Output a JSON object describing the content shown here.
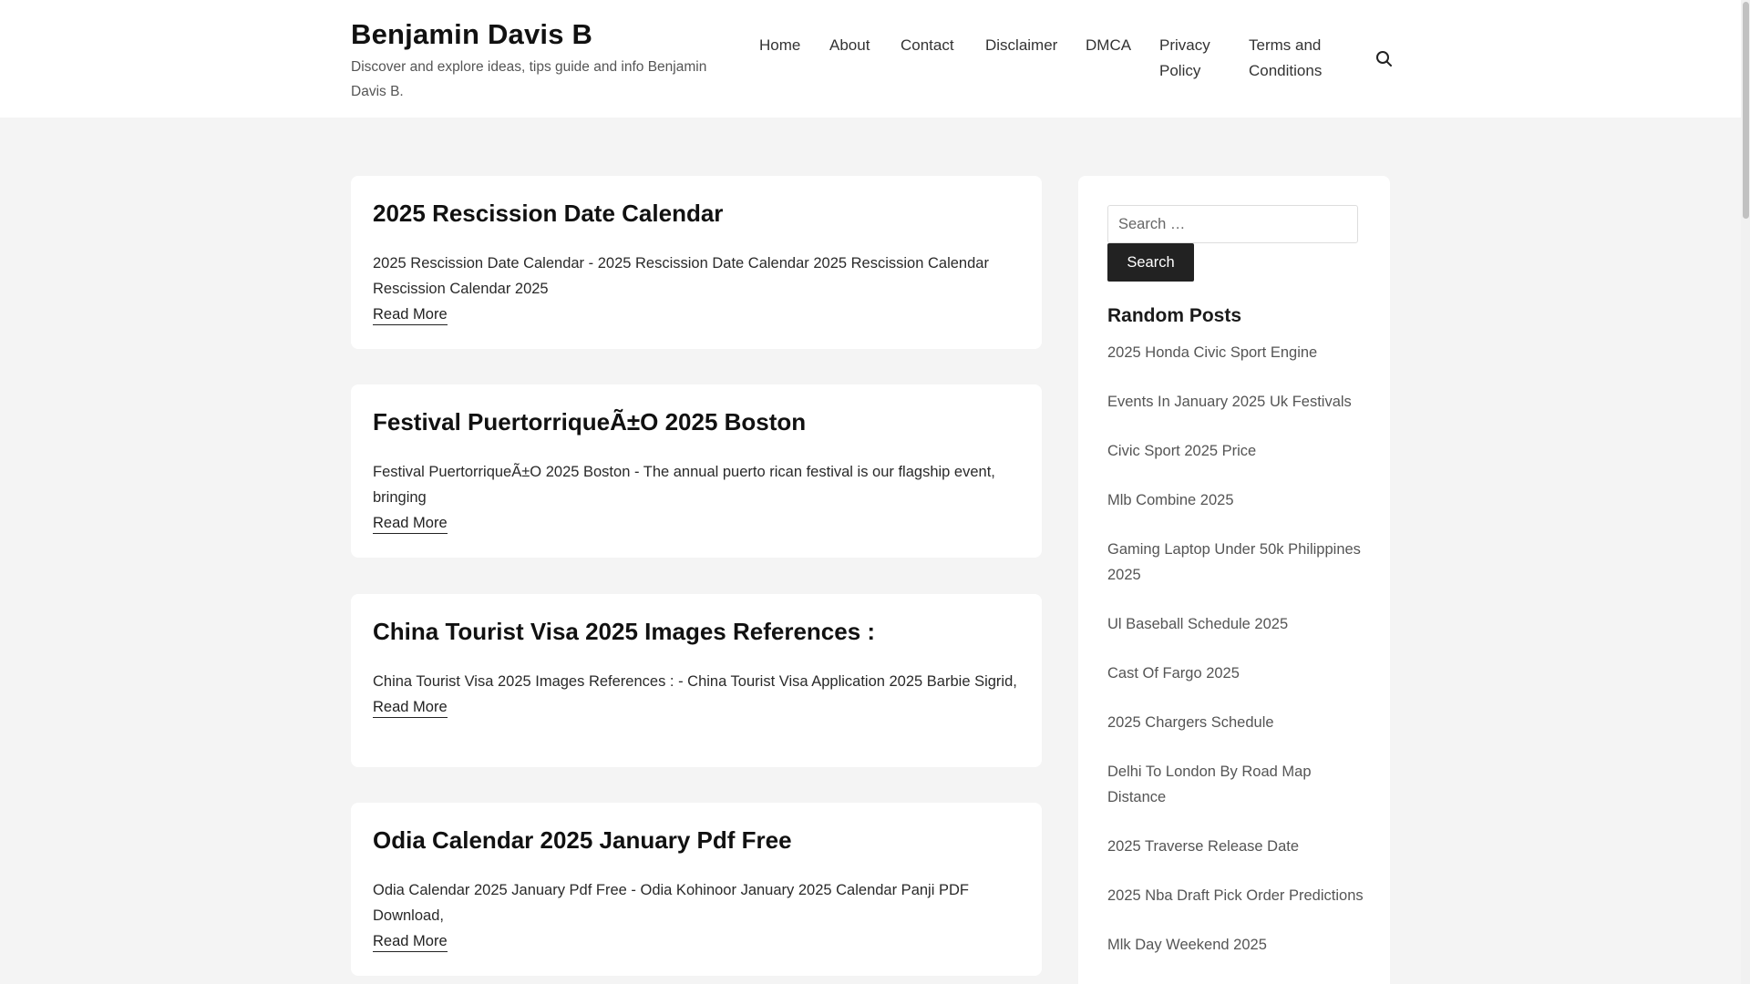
{
  "site": {
    "title": "Benjamin Davis B",
    "tagline": "Discover and explore ideas, tips guide and info Benjamin Davis B."
  },
  "nav": {
    "items": [
      {
        "label": "Home"
      },
      {
        "label": "About"
      },
      {
        "label": "Contact"
      },
      {
        "label": "Disclaimer"
      },
      {
        "label": "DMCA"
      },
      {
        "label": "Privacy Policy"
      },
      {
        "label": "Terms and Conditions"
      }
    ],
    "search_icon": "search-icon"
  },
  "posts": [
    {
      "title": "2025 Rescission Date Calendar",
      "excerpt": "2025 Rescission Date Calendar - 2025 Rescission Date Calendar 2025 Rescission Calendar Rescission Calendar 2025",
      "read_more": "Read More"
    },
    {
      "title": "Festival PuertorriqueÃ±O 2025 Boston",
      "excerpt": "Festival PuertorriqueÃ±O 2025 Boston - The annual puerto rican festival is our flagship event, bringing",
      "read_more": "Read More"
    },
    {
      "title": "China Tourist Visa 2025 Images References :",
      "excerpt": "China Tourist Visa 2025 Images References : - China Tourist Visa Application 2025 Barbie Sigrid,",
      "read_more": "Read More"
    },
    {
      "title": "Odia Calendar 2025 January Pdf Free",
      "excerpt": "Odia Calendar 2025 January Pdf Free - Odia Kohinoor January 2025 Calendar Panji PDF Download,",
      "read_more": "Read More"
    }
  ],
  "sidebar": {
    "search": {
      "placeholder": "Search …",
      "button_label": "Search"
    },
    "random_posts_title": "Random Posts",
    "random_posts": [
      "2025 Honda Civic Sport Engine",
      "Events In January 2025 Uk Festivals",
      "Civic Sport 2025 Price",
      "Mlb Combine 2025",
      "Gaming Laptop Under 50k Philippines 2025",
      "Ul Baseball Schedule 2025",
      "Cast Of Fargo 2025",
      "2025 Chargers Schedule",
      "Delhi To London By Road Map Distance",
      "2025 Traverse Release Date",
      "2025 Nba Draft Pick Order Predictions",
      "Mlk Day Weekend 2025"
    ]
  },
  "colors": {
    "page_bg": "#f4f4f4",
    "card_bg": "#ffffff",
    "button_bg": "#222222"
  }
}
